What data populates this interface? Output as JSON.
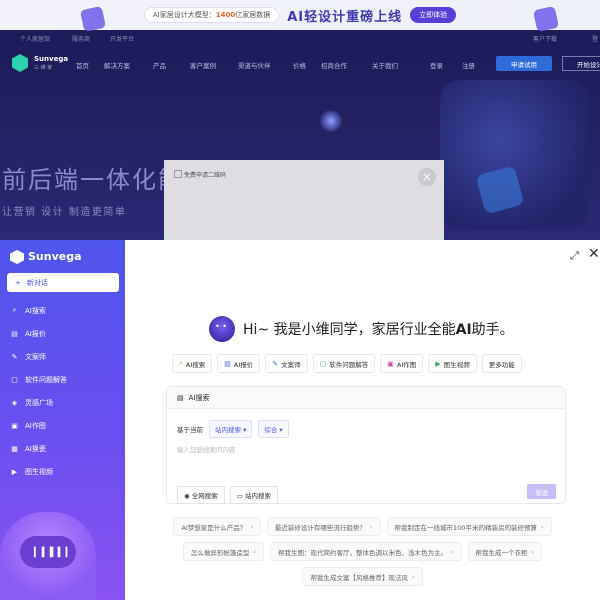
{
  "banner": {
    "pill_prefix": "AI家居设计大模型",
    "pill_number": "1400",
    "pill_suffix": "亿家居数据",
    "headline": "AI轻设计重磅上线",
    "cta": "立即体验"
  },
  "topline": [
    "个人家居馆",
    "服务商",
    "开发平台",
    "客户下载",
    "登"
  ],
  "nav": {
    "brand": "Sunvega",
    "brand_sub": "三 维 家",
    "items": [
      "首页",
      "解决方案",
      "产品",
      "客户案例",
      "渠道与伙伴",
      "价格",
      "招商合作",
      "关于我们"
    ],
    "login": "登录",
    "register": "注册",
    "trial": "申请试用",
    "start": "开始设计"
  },
  "hero": {
    "title": "前后端一体化能",
    "subtitle": "让营销 设计 制造更简单"
  },
  "modal": {
    "image_alt": "免费申请二维码",
    "close": "×"
  },
  "sidebar": {
    "brand": "Sunvega",
    "new_chat": "新对话",
    "items": [
      {
        "label": "AI搜索",
        "icon": "search-icon",
        "glyph": "⌕"
      },
      {
        "label": "AI报价",
        "icon": "quote-icon",
        "glyph": "▤"
      },
      {
        "label": "文案师",
        "icon": "pen-icon",
        "glyph": "✎"
      },
      {
        "label": "软件问题解答",
        "icon": "qa-icon",
        "glyph": "▢"
      },
      {
        "label": "灵感广场",
        "icon": "inspiration-icon",
        "glyph": "◈"
      },
      {
        "label": "AI作图",
        "icon": "image-icon",
        "glyph": "▣"
      },
      {
        "label": "AI换瓷",
        "icon": "tile-icon",
        "glyph": "▦"
      },
      {
        "label": "图生视频",
        "icon": "video-icon",
        "glyph": "▶"
      }
    ]
  },
  "main": {
    "expand": "⤢",
    "close": "✕",
    "greeting_hi": "Hi~ ",
    "greeting_text": "我是小维同学，家居行业全能",
    "greeting_ai": "AI",
    "greeting_end": "助手。",
    "chips": [
      {
        "label": "AI搜索",
        "glyph": "⌕",
        "color": "#e0a040"
      },
      {
        "label": "AI报价",
        "glyph": "▤",
        "color": "#4a6be0"
      },
      {
        "label": "文案师",
        "glyph": "✎",
        "color": "#4a6be0"
      },
      {
        "label": "软件问题解答",
        "glyph": "▢",
        "color": "#3aa860"
      },
      {
        "label": "AI作图",
        "glyph": "▣",
        "color": "#c94aa8"
      },
      {
        "label": "图生视频",
        "glyph": "▶",
        "color": "#3aa860"
      },
      {
        "label": "更多功能",
        "glyph": "",
        "color": "#333333"
      }
    ],
    "box": {
      "title": "AI搜索",
      "based_on": "基于当前",
      "scope": "站内搜索",
      "mode": "综合",
      "placeholder": "输入您想搜索的内容",
      "btn_web": "全网搜索",
      "btn_site": "站内搜索",
      "send": "发送"
    },
    "suggestions": [
      [
        "AI梦想家是什么产品？",
        "最近装修设计有哪些流行趋势？",
        "帮我制定在一线城市100平米的精装房的装修预算"
      ],
      [
        "怎么做异形帐篷造型",
        "帮我生图：现代简约客厅，整体色调以米色、浅木色为主。",
        "帮我生成一个衣柜"
      ],
      [
        "帮我生成文案【风格推荐】现法风"
      ]
    ]
  }
}
